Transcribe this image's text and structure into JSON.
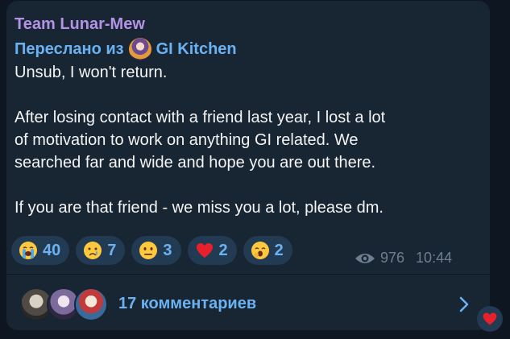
{
  "message": {
    "channel_name": "Team Lunar-Mew",
    "forwarded_prefix": "Переслано из",
    "forwarded_source": "GI Kitchen",
    "lines": [
      "Unsub, I won't return.",
      "",
      "After losing contact with a friend last year, I lost a lot",
      "of motivation to work on anything GI related. We",
      "searched far and wide and hope you are out there.",
      "",
      "If you are that friend - we miss you a lot, please dm."
    ],
    "views": "976",
    "time": "10:44"
  },
  "reactions": [
    {
      "icon": "loudly-crying-face-emoji",
      "count": "40"
    },
    {
      "icon": "crying-face-emoji",
      "count": "7"
    },
    {
      "icon": "neutral-face-emoji",
      "count": "3"
    },
    {
      "icon": "red-heart-emoji",
      "count": "2"
    },
    {
      "icon": "yawning-face-emoji",
      "count": "2"
    }
  ],
  "comments": {
    "label": "17 комментариев"
  },
  "floating_reaction": {
    "icon": "red-heart-emoji"
  },
  "colors": {
    "background": "#0e1621",
    "bubble": "#182533",
    "accent": "#6ab2f2",
    "channel_name": "#b493e6",
    "reaction_bg": "#233a53",
    "meta": "#6d7f8f"
  }
}
